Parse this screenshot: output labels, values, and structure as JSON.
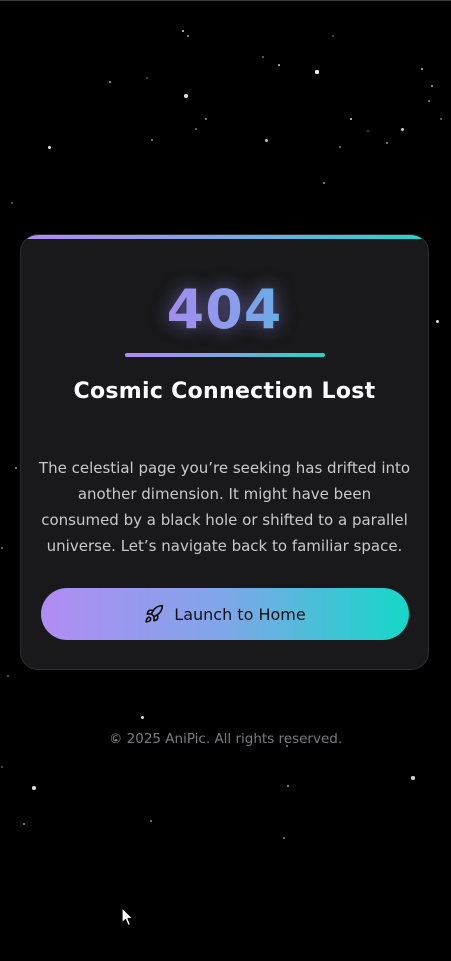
{
  "error_card": {
    "code": "404",
    "title": "Cosmic Connection Lost",
    "message": "The celestial page you’re seeking has drifted into another dimension. It might have been consumed by a black hole or shifted to a parallel universe. Let’s navigate back to familiar space."
  },
  "launch_button": {
    "label": "Launch to Home",
    "icon": "rocket-icon"
  },
  "footer": {
    "text": "© 2025 AniPic. All rights reserved."
  },
  "theme": {
    "background": "#000000",
    "card_background": "#19191b",
    "gradient_start": "#b489f2",
    "gradient_mid": "#7fa6e6",
    "gradient_end": "#1fd6c9",
    "title_color": "#ffffff",
    "body_text_color": "#c9c9cd",
    "footer_text_color": "#7b7b80"
  },
  "decorations": {
    "background_style": "starfield",
    "pointer": "arrow-cursor-icon"
  }
}
